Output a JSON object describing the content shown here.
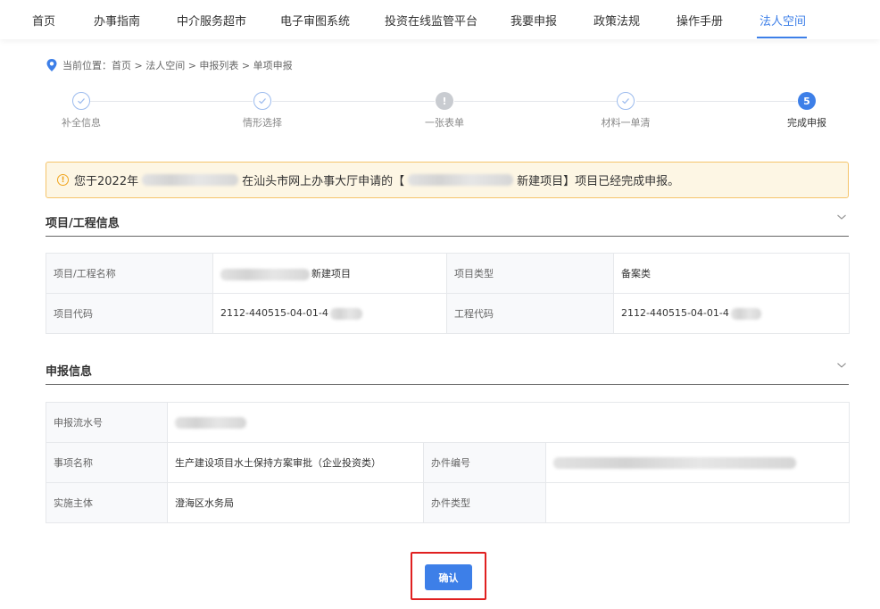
{
  "nav": {
    "items": [
      "首页",
      "办事指南",
      "中介服务超市",
      "电子审图系统",
      "投资在线监管平台",
      "我要申报",
      "政策法规",
      "操作手册",
      "法人空间"
    ],
    "active_index": 8
  },
  "breadcrumb": {
    "prefix": "当前位置：",
    "path": "首页 > 法人空间 > 申报列表 > 单项申报"
  },
  "steps": [
    {
      "label": "补全信息",
      "state": "done",
      "marker": ""
    },
    {
      "label": "情形选择",
      "state": "done",
      "marker": ""
    },
    {
      "label": "一张表单",
      "state": "warn",
      "marker": "!"
    },
    {
      "label": "材料一单清",
      "state": "done",
      "marker": ""
    },
    {
      "label": "完成申报",
      "state": "current",
      "marker": "5"
    }
  ],
  "alert": {
    "part1": "您于2022年",
    "part2": "在汕头市网上办事大厅申请的【",
    "part3": "新建项目】项目已经完成申报。"
  },
  "project_section": {
    "title": "项目/工程信息",
    "rows": [
      {
        "l1": "项目/工程名称",
        "v1": "新建项目",
        "l2": "项目类型",
        "v2": "备案类"
      },
      {
        "l1": "项目代码",
        "v1": "2112-440515-04-01-4",
        "l2": "工程代码",
        "v2": "2112-440515-04-01-4"
      }
    ]
  },
  "apply_section": {
    "title": "申报信息",
    "serial_label": "申报流水号",
    "item_label": "事项名称",
    "item_value": "生产建设项目水土保持方案审批（企业投资类）",
    "case_no_label": "办件编号",
    "subject_label": "实施主体",
    "subject_value": "澄海区水务局",
    "case_type_label": "办件类型",
    "case_type_value": ""
  },
  "confirm_label": "确认",
  "colors": {
    "accent": "#3d7fe8",
    "alert_border": "#f5c46b",
    "alert_bg": "#fdf6e4",
    "highlight": "#e02020"
  }
}
